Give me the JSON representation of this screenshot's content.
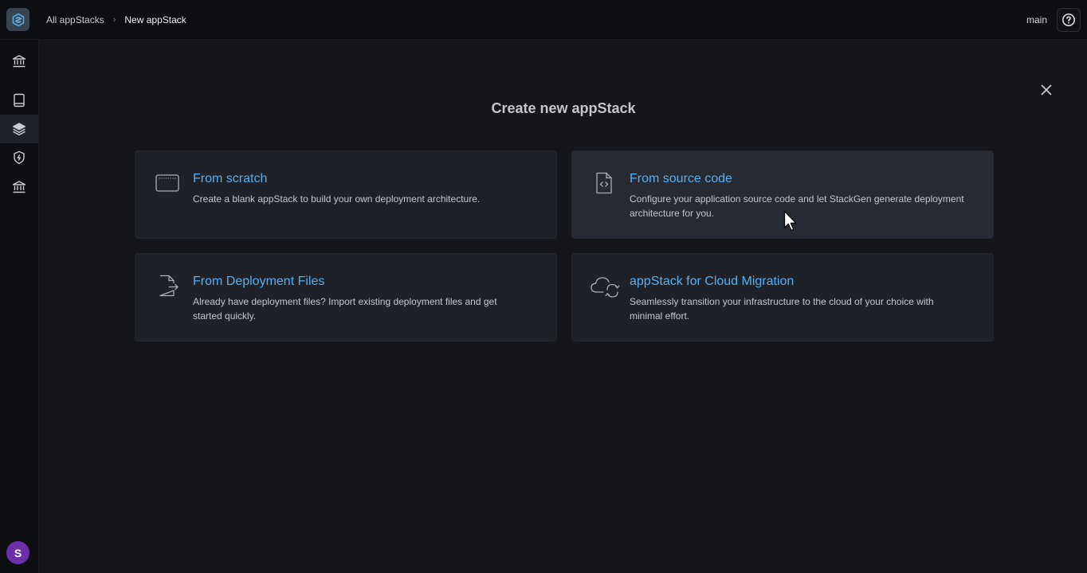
{
  "topbar": {
    "breadcrumb": {
      "items": [
        {
          "label": "All appStacks"
        },
        {
          "label": "New appStack"
        }
      ],
      "separator": "›"
    },
    "branch": "main",
    "logo_icon": "stackgen-logo-icon",
    "help_icon": "help-circle-icon"
  },
  "sidebar": {
    "items": [
      {
        "icon": "bank-icon"
      },
      {
        "icon": "book-icon"
      },
      {
        "icon": "layers-icon",
        "active": true
      },
      {
        "icon": "shield-icon"
      },
      {
        "icon": "institution-icon"
      }
    ],
    "avatar_initial": "S",
    "avatar_color": "#6b2fa8"
  },
  "main": {
    "title": "Create new appStack",
    "close_icon": "close-icon",
    "cards": [
      {
        "title": "From scratch",
        "description": "Create a blank appStack to build your own deployment architecture.",
        "icon": "window-icon"
      },
      {
        "title": "From source code",
        "description": "Configure your application source code and let StackGen generate deployment architecture for you.",
        "icon": "code-file-icon",
        "hovered": true
      },
      {
        "title": "From Deployment Files",
        "description": "Already have deployment files? Import existing deployment files and get started quickly.",
        "icon": "file-import-icon"
      },
      {
        "title": "appStack for Cloud Migration",
        "description": "Seamlessly transition your infrastructure to the cloud of your choice with minimal effort.",
        "icon": "cloud-sync-icon"
      }
    ]
  },
  "colors": {
    "accent_title": "#5aaef0",
    "background": "#14161a",
    "card": "#1e2228"
  }
}
